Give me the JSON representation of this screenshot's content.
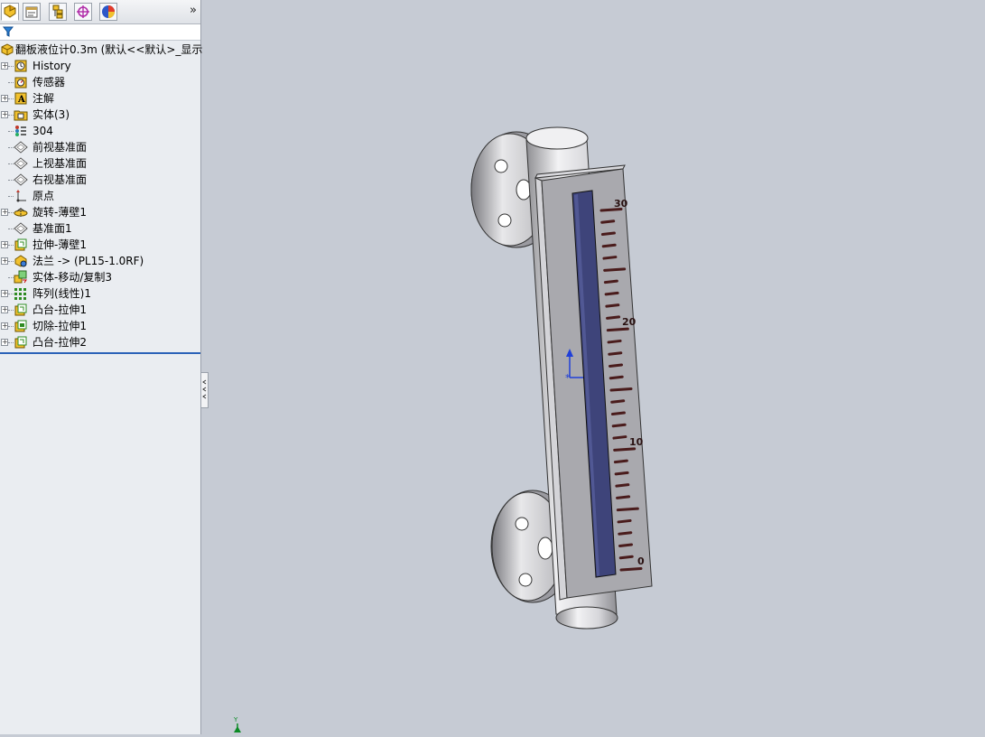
{
  "app": "SolidWorks FeatureManager",
  "tabs": [
    {
      "icon": "feature-manager-icon"
    },
    {
      "icon": "property-manager-icon"
    },
    {
      "icon": "configuration-manager-icon"
    },
    {
      "icon": "dimxpert-manager-icon"
    },
    {
      "icon": "display-manager-icon"
    }
  ],
  "more_label": "»",
  "tree": {
    "root_label": "翻板液位计0.3m  (默认<<默认>_显示",
    "items": [
      {
        "label": "History",
        "icon": "history-icon",
        "expandable": true
      },
      {
        "label": "传感器",
        "icon": "sensor-icon",
        "expandable": false
      },
      {
        "label": "注解",
        "icon": "annotation-icon",
        "expandable": true
      },
      {
        "label": "实体(3)",
        "icon": "solid-bodies-folder-icon",
        "expandable": true
      },
      {
        "label": "304",
        "icon": "material-icon",
        "expandable": false
      },
      {
        "label": "前视基准面",
        "icon": "plane-icon",
        "expandable": false
      },
      {
        "label": "上视基准面",
        "icon": "plane-icon",
        "expandable": false
      },
      {
        "label": "右视基准面",
        "icon": "plane-icon",
        "expandable": false
      },
      {
        "label": "原点",
        "icon": "origin-icon",
        "expandable": false
      },
      {
        "label": "旋转-薄壁1",
        "icon": "revolve-icon",
        "expandable": true
      },
      {
        "label": "基准面1",
        "icon": "plane-icon",
        "expandable": false
      },
      {
        "label": "拉伸-薄壁1",
        "icon": "extrude-icon",
        "expandable": true
      },
      {
        "label": "法兰 -> (PL15-1.0RF)",
        "icon": "library-feature-icon",
        "expandable": true
      },
      {
        "label": "实体-移动/复制3",
        "icon": "move-copy-icon",
        "expandable": false
      },
      {
        "label": "阵列(线性)1",
        "icon": "linear-pattern-icon",
        "expandable": true
      },
      {
        "label": "凸台-拉伸1",
        "icon": "extrude-icon",
        "expandable": true
      },
      {
        "label": "切除-拉伸1",
        "icon": "cut-extrude-icon",
        "expandable": true
      },
      {
        "label": "凸台-拉伸2",
        "icon": "extrude-icon",
        "expandable": true
      }
    ]
  },
  "model": {
    "scale_labels": [
      "30",
      "20",
      "10",
      "0"
    ],
    "colors": {
      "background": "#c6cbd4",
      "window": "#3e447a",
      "body": "#a9a9ae",
      "scale_marks": "#4a1c1c"
    }
  },
  "triad_label": "Y"
}
